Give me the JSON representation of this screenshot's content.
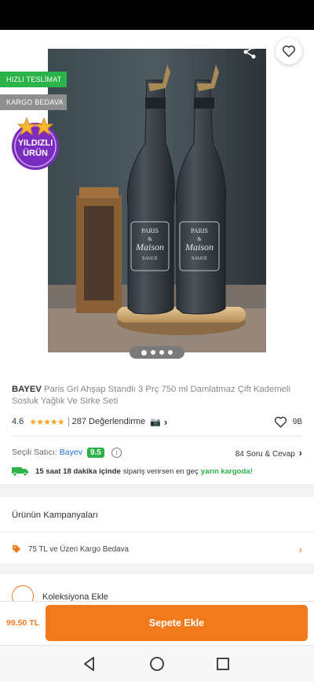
{
  "badges": {
    "fast_delivery": "HIZLI TESLİMAT",
    "free_cargo": "KARGO BEDAVA",
    "star_product_line1": "YILDIZLI",
    "star_product_line2": "ÜRÜN"
  },
  "product": {
    "brand": "BAYEV",
    "name": "Paris Gri Ahşap Standlı 3 Prç 750 ml Damlatmaz Çift Kademeli Sosluk Yağlık Ve Sirke Seti",
    "rating": "4.6",
    "stars_value": 4.6,
    "review_count": "287 Değerlendirme",
    "favorite_count": "9B",
    "image_count": 4,
    "label_text_line1": "PARIS",
    "label_text_line2": "&",
    "label_text_line3": "Maison",
    "label_text_line4": "SAUCE"
  },
  "seller": {
    "label": "Seçili Satıcı:",
    "name": "Bayev",
    "score": "9.5",
    "qa": "84 Soru & Cevap"
  },
  "delivery": {
    "time": "15 saat 18 dakika içinde",
    "text": "sipariş verirsen en geç",
    "highlight": "yarın kargoda!"
  },
  "campaigns": {
    "title": "Ürünün Kampanyaları",
    "item": "75 TL ve Üzeri Kargo Bedava"
  },
  "collection": {
    "label": "Koleksiyona Ekle"
  },
  "bottom_bar": {
    "price": "99.50 TL",
    "button": "Sepete Ekle"
  },
  "colors": {
    "accent": "#f27a1a",
    "green": "#2bb34a",
    "seller_link": "#1a6fd6"
  }
}
